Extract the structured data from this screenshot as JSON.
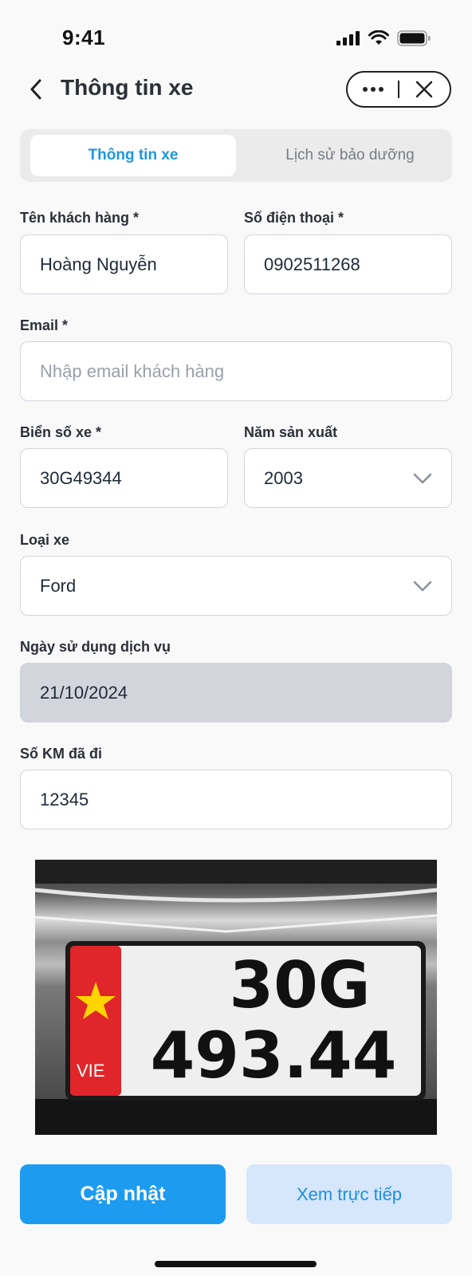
{
  "status_bar": {
    "time": "9:41"
  },
  "header": {
    "title": "Thông tin xe"
  },
  "tabs": [
    {
      "label": "Thông tin xe",
      "active": true
    },
    {
      "label": "Lịch sử bảo dưỡng",
      "active": false
    }
  ],
  "form": {
    "customer_name": {
      "label": "Tên khách hàng *",
      "value": "Hoàng Nguyễn"
    },
    "phone": {
      "label": "Số điện thoại *",
      "value": "0902511268"
    },
    "email": {
      "label": "Email *",
      "value": "",
      "placeholder": "Nhập email khách hàng"
    },
    "plate": {
      "label": "Biển số xe *",
      "value": "30G49344"
    },
    "year": {
      "label": "Năm sản xuất",
      "value": "2003"
    },
    "car_type": {
      "label": "Loại xe",
      "value": "Ford"
    },
    "service_date": {
      "label": "Ngày sử dụng dịch vụ",
      "value": "21/10/2024"
    },
    "km": {
      "label": "Số KM đã đi",
      "value": "12345"
    }
  },
  "plate_photo": {
    "line1": "30G",
    "line2": "493.44",
    "country": "VIE"
  },
  "actions": {
    "update": "Cập nhật",
    "view_live": "Xem trực tiếp"
  },
  "colors": {
    "accent": "#1d9bf0",
    "secondary_bg": "#d6e6fb",
    "disabled_bg": "#d2d5dc"
  }
}
